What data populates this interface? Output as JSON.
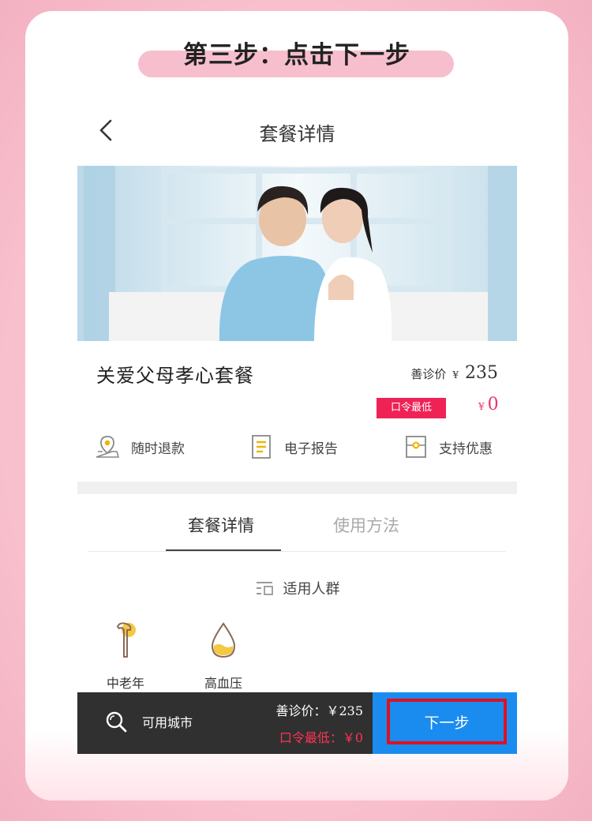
{
  "banner": {
    "text": "第三步：点击下一步"
  },
  "nav": {
    "title": "套餐详情"
  },
  "package": {
    "name": "关爱父母孝心套餐",
    "price_label": "善诊价",
    "price_currency": "¥",
    "price": "235",
    "code_badge": "口令最低",
    "code_currency": "¥",
    "code_price": "0"
  },
  "features": [
    {
      "label": "随时退款",
      "icon": "location-refund-icon"
    },
    {
      "label": "电子报告",
      "icon": "document-icon"
    },
    {
      "label": "支持优惠",
      "icon": "coupon-icon"
    }
  ],
  "tabs": [
    {
      "label": "套餐详情",
      "active": true
    },
    {
      "label": "使用方法",
      "active": false
    }
  ],
  "section": {
    "title": "适用人群",
    "icon": "list-icon"
  },
  "crowds": [
    {
      "label": "中老年",
      "icon": "cane-icon"
    },
    {
      "label": "高血压",
      "icon": "blood-drop-icon"
    }
  ],
  "bottom_bar": {
    "city_label": "可用城市",
    "price_line": "善诊价：￥235",
    "code_line": "口令最低：￥0",
    "next_label": "下一步"
  },
  "colors": {
    "accent_pink": "#ee2255",
    "button_blue": "#1a8cf0",
    "highlight_red": "#e0101e",
    "bar_dark": "#303030"
  }
}
